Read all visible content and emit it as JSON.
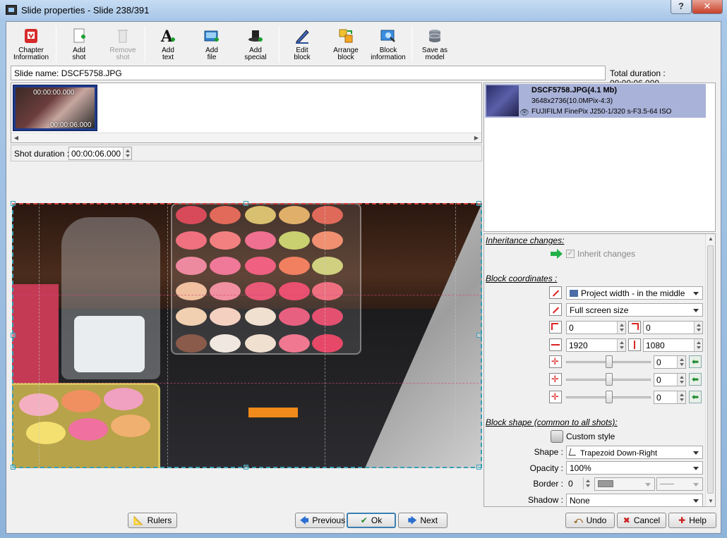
{
  "window": {
    "title": "Slide properties - Slide 238/391",
    "help_btn": "?",
    "close_btn": "✕"
  },
  "toolbar": {
    "chapter_info": [
      "Chapter",
      "Information"
    ],
    "add_shot": [
      "Add",
      "shot"
    ],
    "remove_shot": [
      "Remove",
      "shot"
    ],
    "add_text": [
      "Add",
      "text"
    ],
    "add_file": [
      "Add",
      "file"
    ],
    "add_special": [
      "Add",
      "special"
    ],
    "edit_block": [
      "Edit",
      "block"
    ],
    "arrange_block": [
      "Arrange",
      "block"
    ],
    "block_information": [
      "Block",
      "information"
    ],
    "save_as_model": [
      "Save as",
      "model"
    ]
  },
  "slide_name": {
    "label": "Slide name:",
    "value": "DSCF5758.JPG",
    "total_duration": "Total duration : 00:00:06.000"
  },
  "shots": [
    {
      "start": "00:00:00.000",
      "duration": "00:00:06.000"
    }
  ],
  "shot_duration": {
    "label": "Shot duration :",
    "value": "00:00:06.000"
  },
  "media": {
    "name": "DSCF5758.JPG(4.1 Mb)",
    "resolution": "3648x2736(10.0MPix-4:3)",
    "exif": "FUJIFILM FinePix J250-1/320 s-F3.5-64 ISO"
  },
  "props": {
    "inheritance_title": "Inheritance changes:",
    "inherit_label": "Inherit changes",
    "block_coords_title": "Block coordinates :",
    "position_mode": "Project width - in the middle",
    "size_mode": "Full screen size",
    "x": "0",
    "y": "0",
    "width": "1920",
    "height": "1080",
    "rot_x": "0",
    "rot_y": "0",
    "rot_z": "0",
    "shape_title": "Block shape (common to all shots):",
    "custom_style": "Custom style",
    "shape_label": "Shape :",
    "shape_value": "Trapezoid Down-Right",
    "opacity_label": "Opacity :",
    "opacity_value": "100%",
    "border_label": "Border :",
    "border_value": "0",
    "shadow_label": "Shadow :",
    "shadow_value": "None"
  },
  "buttons": {
    "rulers": "Rulers",
    "previous": "Previous",
    "ok": "Ok",
    "next": "Next",
    "undo": "Undo",
    "cancel": "Cancel",
    "help": "Help"
  }
}
